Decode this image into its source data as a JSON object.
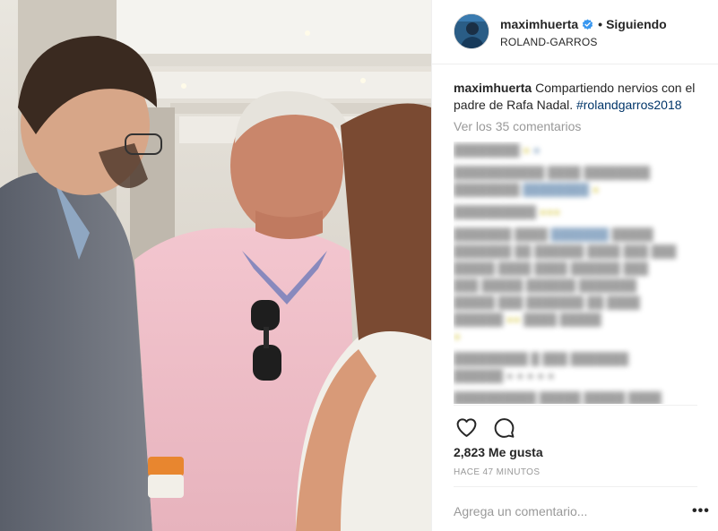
{
  "post": {
    "username": "maximhuerta",
    "follow_status": "Siguiendo",
    "separator": "•",
    "location": "ROLAND-GARROS",
    "caption_username": "maximhuerta",
    "caption_text": "Compartiendo nervios con el padre de Rafa Nadal.",
    "caption_hashtag": "#rolandgarros2018",
    "view_comments": "Ver los 35 comentarios",
    "likes": "2,823 Me gusta",
    "time": "HACE 47 MINUTOS",
    "comment_placeholder": "Agrega un comentario...",
    "options_label": "•••"
  },
  "icons": {
    "verified": "verified-badge-icon",
    "like": "heart-outline-icon",
    "comment": "comment-bubble-icon",
    "options": "more-options-icon"
  },
  "colors": {
    "text": "#262626",
    "muted": "#999999",
    "hashtag": "#003569",
    "verified": "#3897f0",
    "divider": "#efefef"
  }
}
